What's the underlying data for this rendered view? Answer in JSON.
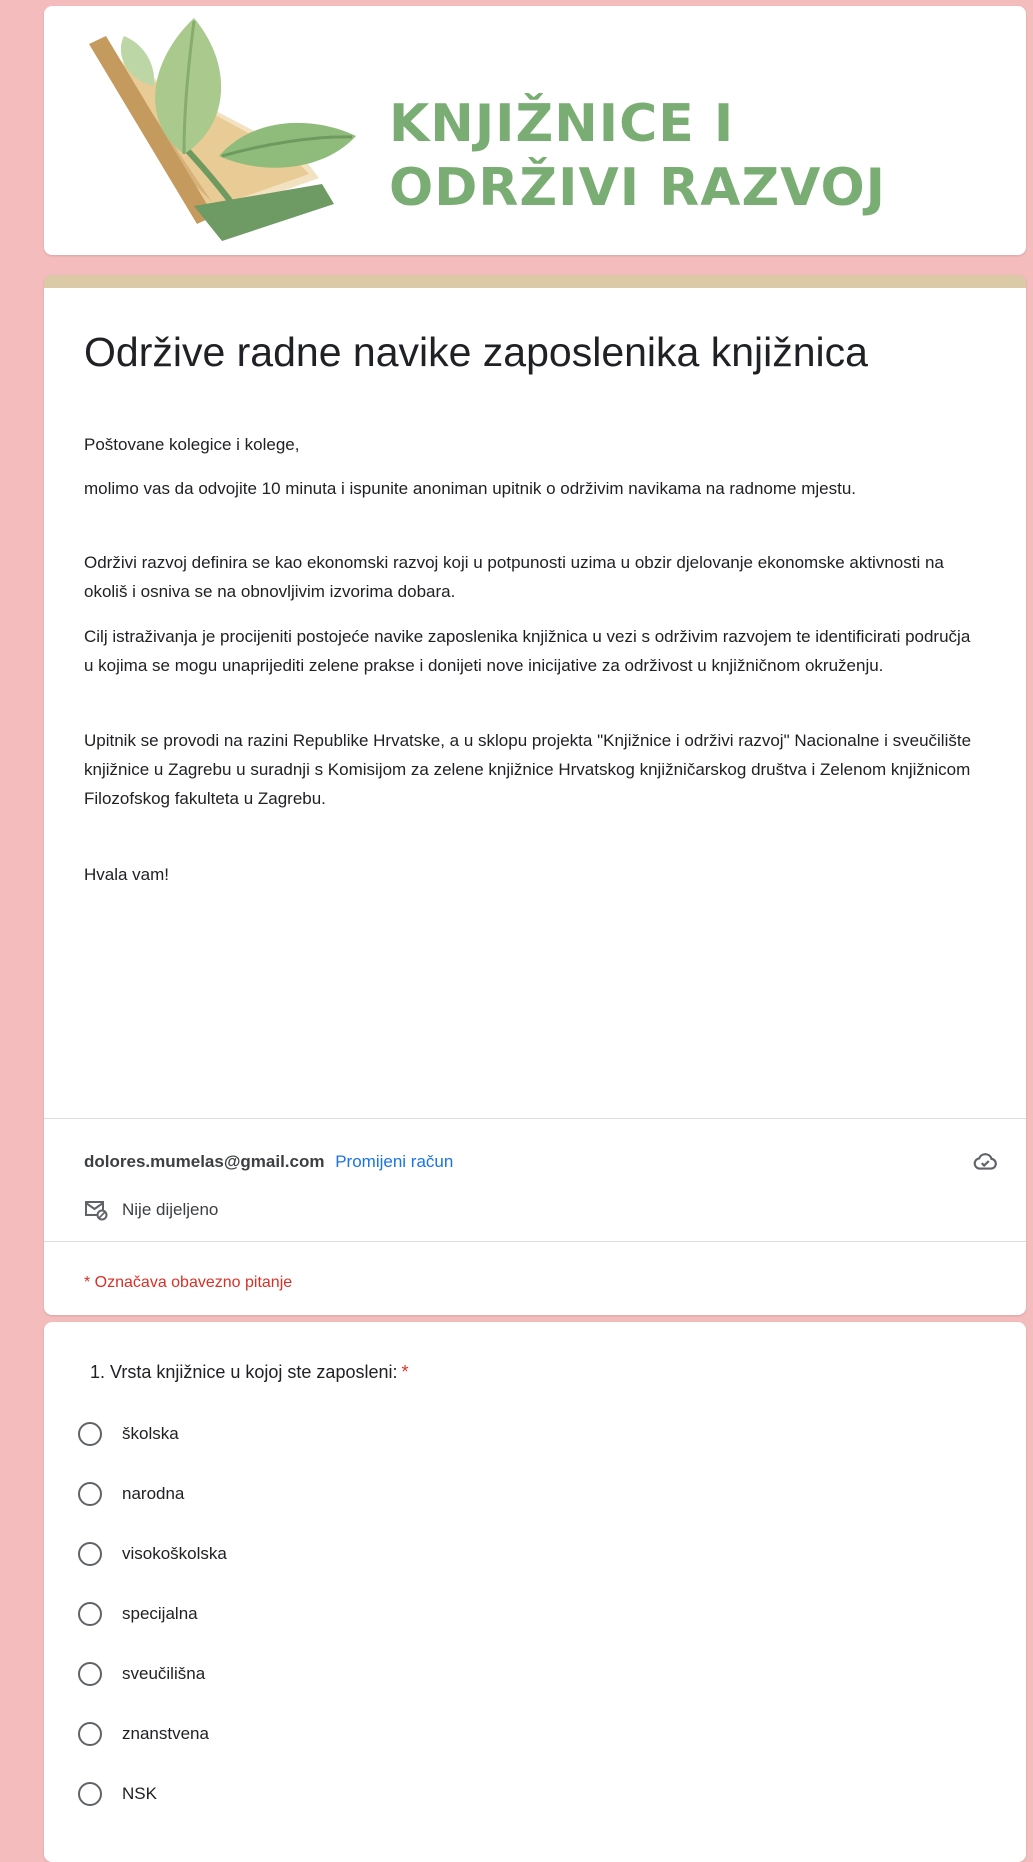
{
  "header": {
    "logo_line1": "KNJIŽNICE I",
    "logo_line2": "ODRŽIVI RAZVOJ",
    "logo_color": "#7aad73"
  },
  "form": {
    "title": "Održive radne navike zaposlenika knjižnica",
    "description": [
      "Poštovane kolegice i kolege,",
      "molimo vas da odvojite 10 minuta i ispunite anoniman upitnik o održivim navikama na radnome mjestu.",
      "Održivi razvoj definira se kao ekonomski razvoj koji u potpunosti uzima u obzir djelovanje ekonomske aktivnosti na okoliš i osniva se na obnovljivim izvorima dobara.",
      "Cilj istraživanja je procijeniti postojeće navike zaposlenika knjižnica u vezi s održivim razvojem te identificirati područja u kojima se mogu unaprijediti zelene prakse i donijeti nove inicijative za održivost u knjižničnom okruženju.",
      "Upitnik se provodi na razini Republike Hrvatske, a u sklopu projekta \"Knjižnice i održivi razvoj\" Nacionalne i sveučilište knjižnice u Zagrebu u suradnji s Komisijom za zelene knjižnice Hrvatskog knjižničarskog društva i Zelenom knjižnicom Filozofskog fakulteta u Zagrebu.",
      "Hvala vam!"
    ],
    "theme_color": "#dcc9a6"
  },
  "account": {
    "email": "dolores.mumelas@gmail.com",
    "switch_label": "Promijeni račun",
    "sharing_status": "Nije dijeljeno",
    "cloud_icon": "cloud-saved-icon",
    "mail_icon": "mail-not-shared-icon"
  },
  "required_note": "* Označava obavezno pitanje",
  "question": {
    "title": "1. Vrsta knjižnice u kojoj ste zaposleni:",
    "required_marker": "*",
    "options": [
      "školska",
      "narodna",
      "visokoškolska",
      "specijalna",
      "sveučilišna",
      "znanstvena",
      "NSK"
    ]
  }
}
